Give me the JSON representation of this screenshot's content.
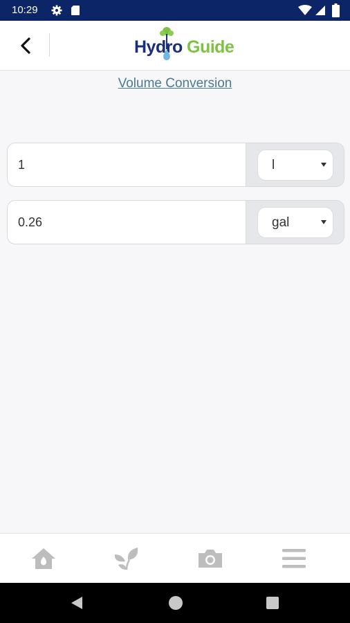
{
  "status_bar": {
    "time": "10:29"
  },
  "header": {
    "logo_hydro": "Hydro",
    "logo_guide": "Guide"
  },
  "page": {
    "title": "Volume Conversion"
  },
  "converter": {
    "from": {
      "value": "1",
      "unit": "l"
    },
    "to": {
      "value": "0.26",
      "unit": "gal"
    }
  },
  "bottom_nav": {
    "items": [
      "home-icon",
      "leaves-icon",
      "camera-icon",
      "menu-icon"
    ]
  },
  "colors": {
    "status_bar": "#0c2566",
    "logo_blue": "#1a2f7a",
    "logo_green": "#7dc242",
    "title_link": "#4a7a8e",
    "nav_icon": "#bdbdbd"
  }
}
